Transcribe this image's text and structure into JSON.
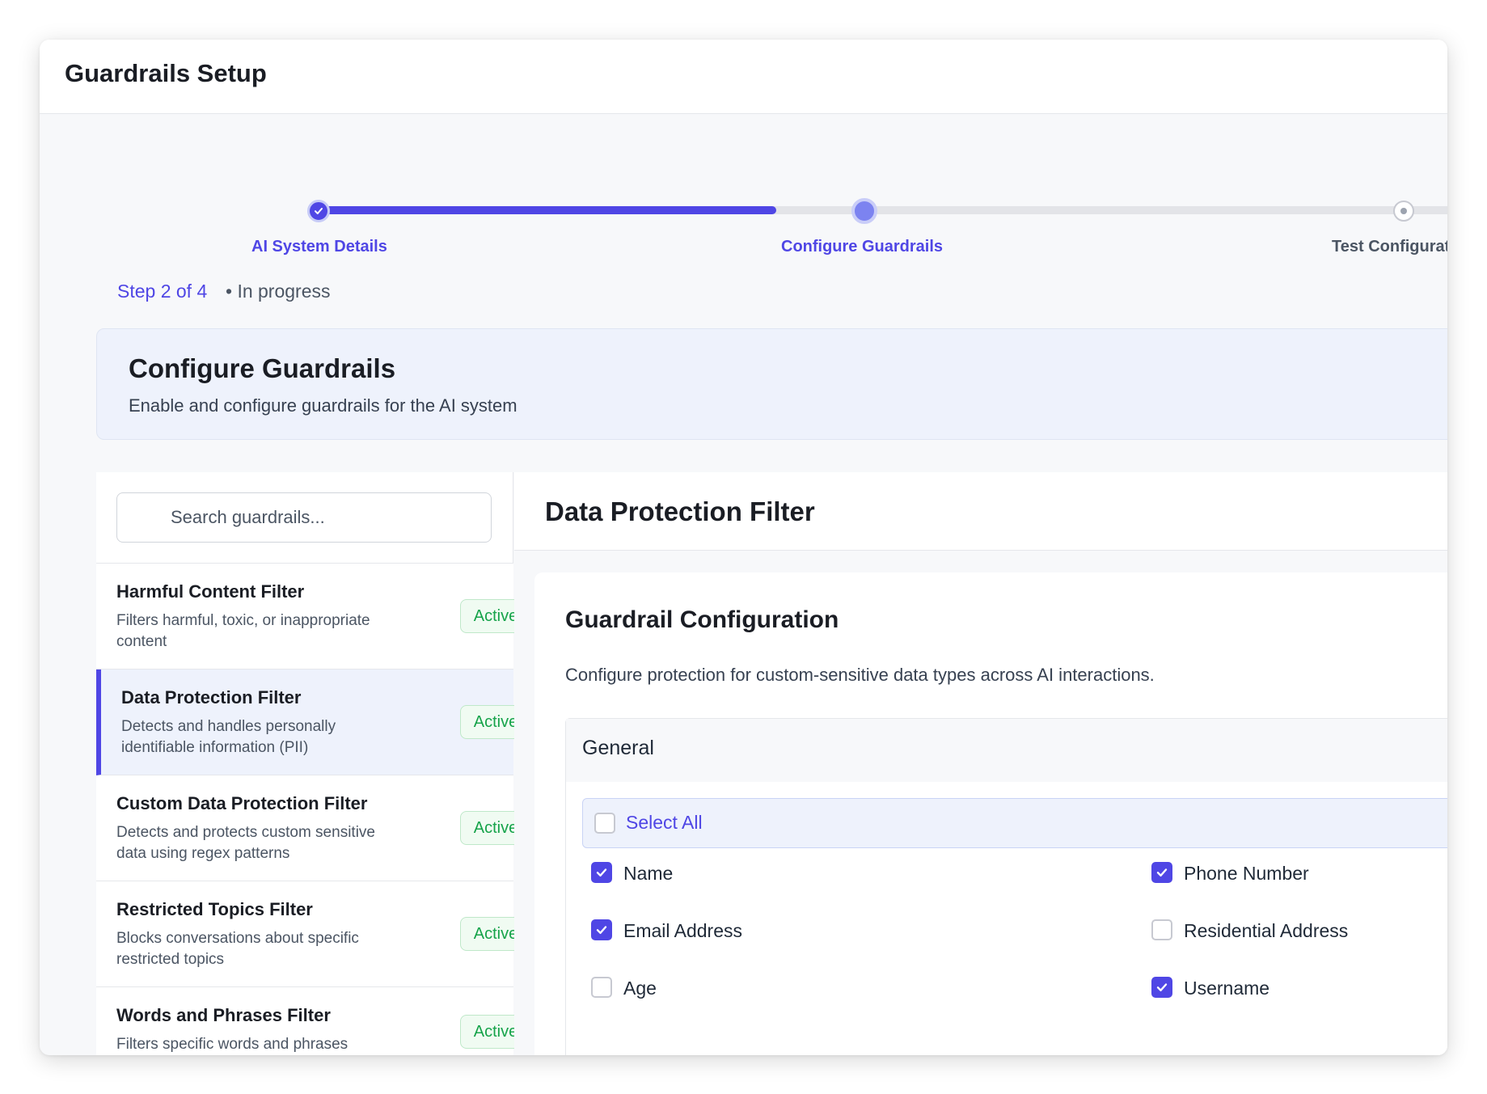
{
  "app": {
    "title": "Guardrails Setup"
  },
  "stepper": {
    "steps": [
      {
        "label": "AI System Details",
        "state": "done"
      },
      {
        "label": "Configure Guardrails",
        "state": "current"
      },
      {
        "label": "Test Configurat",
        "state": "upcoming"
      }
    ],
    "progress_fraction": 0.39,
    "step_count": "Step 2 of 4",
    "status": "• In progress"
  },
  "banner": {
    "title": "Configure Guardrails",
    "subtitle": "Enable and configure guardrails for the AI system"
  },
  "search": {
    "placeholder": "Search guardrails..."
  },
  "guardrails": [
    {
      "name": "Harmful Content Filter",
      "description": "Filters harmful, toxic, or inappropriate content",
      "status": "Active",
      "selected": false
    },
    {
      "name": "Data Protection Filter",
      "description": "Detects and handles personally identifiable information (PII)",
      "status": "Active",
      "selected": true
    },
    {
      "name": "Custom Data Protection Filter",
      "description": "Detects and protects custom sensitive data using regex patterns",
      "status": "Active",
      "selected": false
    },
    {
      "name": "Restricted Topics Filter",
      "description": "Blocks conversations about specific restricted topics",
      "status": "Active",
      "selected": false
    },
    {
      "name": "Words and Phrases Filter",
      "description": "Filters specific words and phrases",
      "status": "Active",
      "selected": false
    }
  ],
  "detail": {
    "title": "Data Protection Filter",
    "config_title": "Guardrail Configuration",
    "config_description": "Configure protection for custom-sensitive data types across AI interactions.",
    "group_title": "General",
    "select_all_label": "Select All",
    "select_all_checked": false,
    "options": [
      {
        "label": "Name",
        "checked": true
      },
      {
        "label": "Phone Number",
        "checked": true
      },
      {
        "label": "Email Address",
        "checked": true
      },
      {
        "label": "Residential Address",
        "checked": false
      },
      {
        "label": "Age",
        "checked": false
      },
      {
        "label": "Username",
        "checked": true
      }
    ]
  },
  "colors": {
    "accent": "#4f46e5",
    "active_badge_text": "#16a34a",
    "active_badge_bg": "#f0fbf2",
    "selected_row_bg": "#eef2fc"
  }
}
